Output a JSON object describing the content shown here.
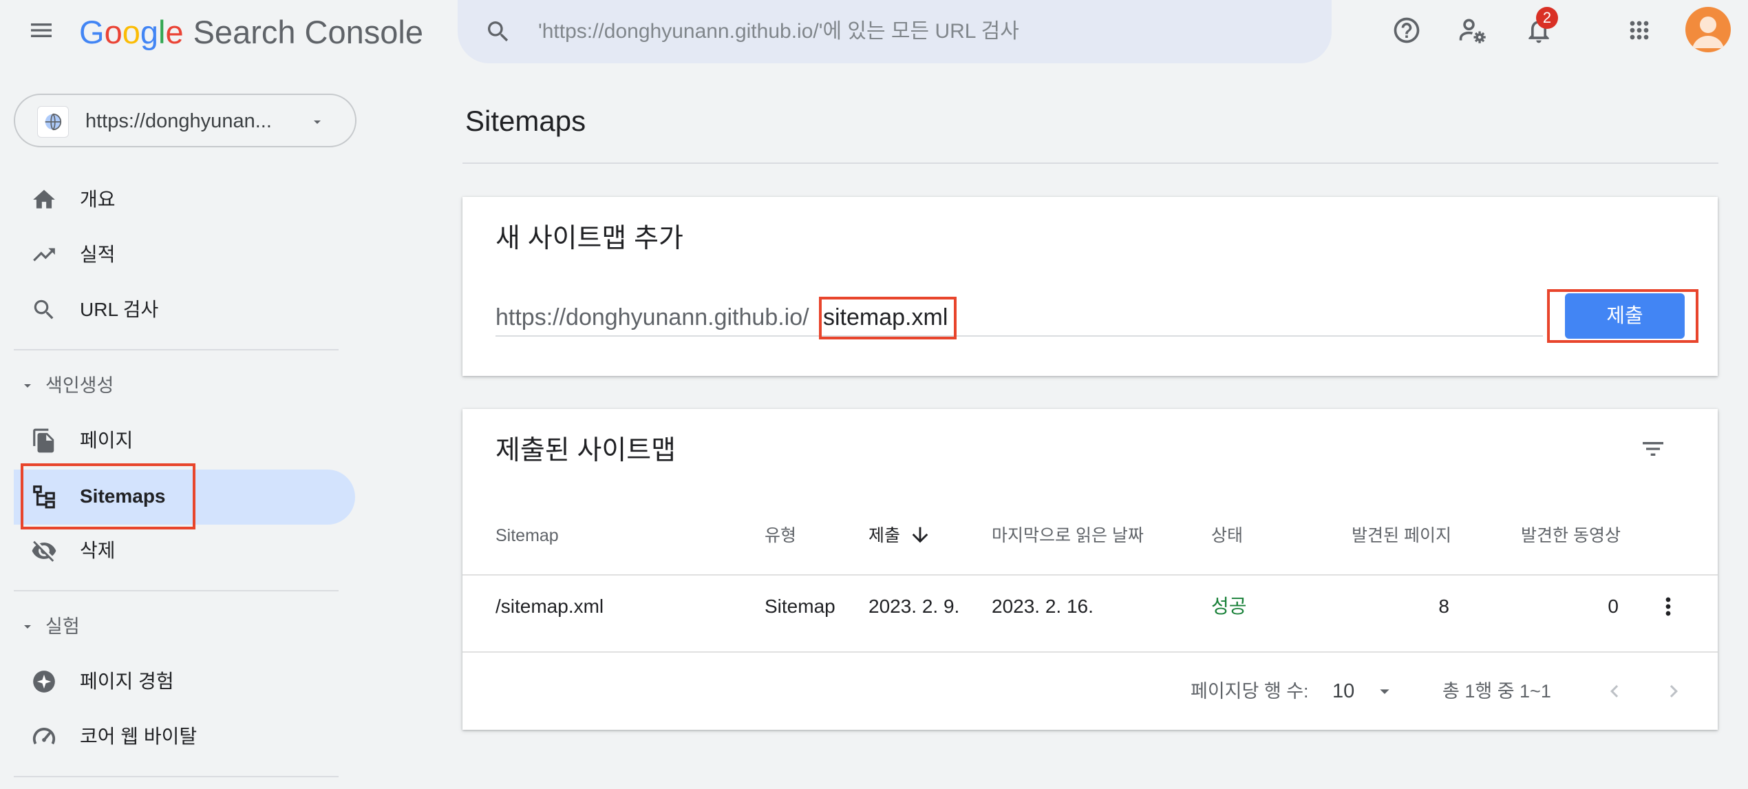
{
  "header": {
    "logo": {
      "g1": "G",
      "o1": "o",
      "o2": "o",
      "g2": "g",
      "l": "l",
      "e": "e",
      "product": "Search Console"
    },
    "search": {
      "placeholder": "'https://donghyunann.github.io/'에 있는 모든 URL 검사"
    },
    "notifications_count": "2",
    "icons": [
      "menu-icon",
      "search-icon",
      "help-icon",
      "admin-settings-icon",
      "notifications-icon",
      "apps-icon",
      "avatar"
    ]
  },
  "sidebar": {
    "property": {
      "label": "https://donghyunan..."
    },
    "items": [
      {
        "label": "개요",
        "icon": "home-icon"
      },
      {
        "label": "실적",
        "icon": "trending-up-icon"
      },
      {
        "label": "URL 검사",
        "icon": "search-icon"
      }
    ],
    "indexing": {
      "heading": "색인생성",
      "items": [
        {
          "label": "페이지",
          "icon": "pages-icon"
        },
        {
          "label": "Sitemaps",
          "icon": "sitemap-icon",
          "active": true
        },
        {
          "label": "삭제",
          "icon": "visibility-off-icon"
        }
      ]
    },
    "experience": {
      "heading": "실험",
      "items": [
        {
          "label": "페이지 경험",
          "icon": "page-experience-icon"
        },
        {
          "label": "코어 웹 바이탈",
          "icon": "speed-gauge-icon"
        }
      ]
    }
  },
  "main": {
    "title": "Sitemaps",
    "add_card": {
      "title": "새 사이트맵 추가",
      "url_prefix": "https://donghyunann.github.io/",
      "input_value": "sitemap.xml",
      "submit_label": "제출"
    },
    "submitted_card": {
      "title": "제출된 사이트맵",
      "columns": [
        "Sitemap",
        "유형",
        "제출",
        "마지막으로 읽은 날짜",
        "상태",
        "발견된 페이지",
        "발견한 동영상"
      ],
      "rows": [
        {
          "sitemap": "/sitemap.xml",
          "type": "Sitemap",
          "submitted": "2023. 2. 9.",
          "last_read": "2023. 2. 16.",
          "status": "성공",
          "pages": "8",
          "videos": "0"
        }
      ],
      "footer": {
        "rows_per_page_label": "페이지당 행 수:",
        "rows_per_page": "10",
        "range": "총 1행 중 1~1"
      }
    }
  },
  "colors": {
    "accent": "#4285f4",
    "active_nav_bg": "#d3e3fd",
    "success": "#188038",
    "highlight_box": "#e8452c",
    "badge": "#d93025"
  }
}
